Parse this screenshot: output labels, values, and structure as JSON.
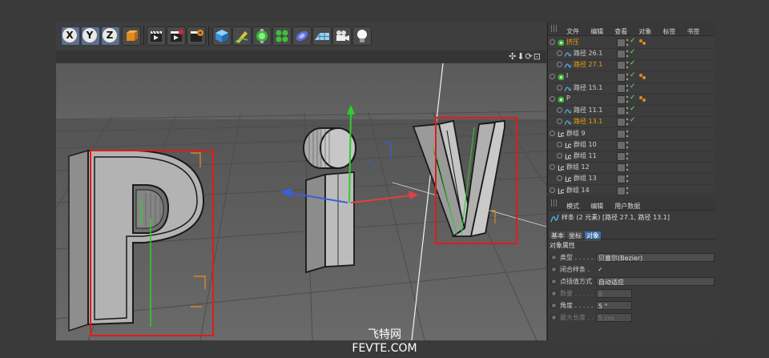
{
  "toolbar": {
    "axis_x": "X",
    "axis_y": "Y",
    "axis_z": "Z"
  },
  "object_manager": {
    "menu": [
      "文件",
      "编辑",
      "查看",
      "对象",
      "标签",
      "书签"
    ],
    "objects": [
      {
        "name": "挤压",
        "kind": "extrude",
        "selected": true
      },
      {
        "name": "路径 26.1",
        "kind": "spline",
        "selected": false
      },
      {
        "name": "路径 27.1",
        "kind": "spline",
        "selected": true
      },
      {
        "name": "I",
        "kind": "extrude",
        "selected": false
      },
      {
        "name": "路径 15.1",
        "kind": "spline",
        "selected": false
      },
      {
        "name": "P",
        "kind": "extrude",
        "selected": false
      },
      {
        "name": "路径 11.1",
        "kind": "spline",
        "selected": false
      },
      {
        "name": "路径 13.1",
        "kind": "spline",
        "selected": true
      },
      {
        "name": "群组 9",
        "kind": "group",
        "selected": false
      },
      {
        "name": "群组 10",
        "kind": "group",
        "selected": false
      },
      {
        "name": "群组 11",
        "kind": "group",
        "selected": false
      },
      {
        "name": "群组 12",
        "kind": "group",
        "selected": false
      },
      {
        "name": "群组 13",
        "kind": "group",
        "selected": false
      },
      {
        "name": "群组 14",
        "kind": "group",
        "selected": false
      }
    ]
  },
  "attributes": {
    "menu": [
      "模式",
      "编辑",
      "用户数据"
    ],
    "header": "样条 (2 元素) [路径 27.1, 路径 13.1]",
    "tabs": [
      "基本",
      "坐标",
      "对象"
    ],
    "active_tab": "对象",
    "section": "对象属性",
    "props": [
      {
        "label": "类型 . . . . . .",
        "value": "贝塞尔(Bezier)",
        "dim": false
      },
      {
        "label": "闭合样条 .",
        "value": "✓",
        "dim": false
      },
      {
        "label": "点插值方式",
        "value": "自动适应",
        "dim": false
      },
      {
        "label": "数量 . . . . . .",
        "value": "8",
        "dim": true
      },
      {
        "label": "角度 . . . . . .",
        "value": "5 °",
        "dim": false
      },
      {
        "label": "最大长度 . .",
        "value": "5 cm",
        "dim": true
      }
    ]
  },
  "viewport": {
    "nav_icons": "✣⬇⟳⊡"
  },
  "watermark": {
    "line1": "飞特网",
    "line2": "FEVTE.COM"
  },
  "colors": {
    "selection_box": "#e21b1b",
    "axis_x": "#e04040",
    "axis_y": "#30c030",
    "axis_z": "#3a5ee0",
    "selected_text": "#f0a000"
  }
}
